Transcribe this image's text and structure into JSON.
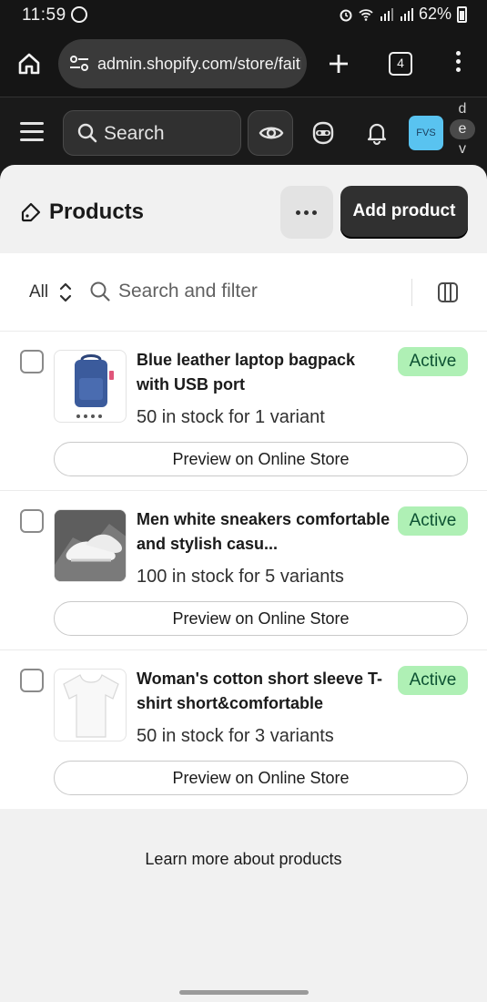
{
  "status_bar": {
    "time": "11:59",
    "battery": "62%"
  },
  "browser": {
    "url": "admin.shopify.com/store/faiti",
    "tab_count": "4"
  },
  "header": {
    "search_label": "Search",
    "store_badge": "FVS",
    "dev_letters": [
      "d",
      "e",
      "v"
    ]
  },
  "page": {
    "title": "Products",
    "add_button": "Add product",
    "filter": {
      "view": "All",
      "search_placeholder": "Search and filter"
    },
    "products": [
      {
        "name": "Blue leather laptop bagpack with USB port",
        "status": "Active",
        "stock": "50 in stock for 1 variant",
        "preview": "Preview on Online Store"
      },
      {
        "name": "Men white sneakers comfortable and stylish casu...",
        "status": "Active",
        "stock": "100 in stock for 5 variants",
        "preview": "Preview on Online Store"
      },
      {
        "name": "Woman's cotton short sleeve T-shirt short&comfortable",
        "status": "Active",
        "stock": "50 in stock for 3 variants",
        "preview": "Preview on Online Store"
      }
    ],
    "learn_more": "Learn more about products"
  },
  "colors": {
    "active_badge_bg": "#aff0b5",
    "active_badge_text": "#0c5132",
    "primary_button": "#303030",
    "store_badge": "#59c3f0"
  }
}
